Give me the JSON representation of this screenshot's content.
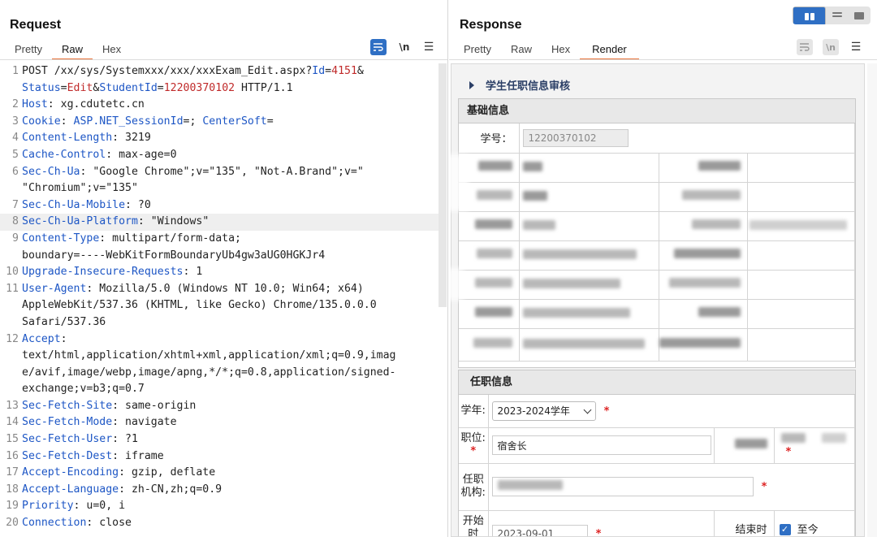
{
  "request": {
    "title": "Request",
    "tabs": [
      "Pretty",
      "Raw",
      "Hex"
    ],
    "active_tab": "Raw",
    "icons": {
      "wrap": "wrap-lines-icon",
      "newline": "\\n",
      "menu": "☰"
    },
    "lines": [
      {
        "n": "1",
        "parts": [
          [
            "plain",
            "POST /xx/sys/Systemxxx/xxx/xxxExam_Edit.aspx?"
          ],
          [
            "pk",
            "Id"
          ],
          [
            "plain",
            "="
          ],
          [
            "pv",
            "4151"
          ],
          [
            "plain",
            "&"
          ]
        ]
      },
      {
        "n": "",
        "parts": [
          [
            "pk",
            "Status"
          ],
          [
            "plain",
            "="
          ],
          [
            "pv",
            "Edit"
          ],
          [
            "plain",
            "&"
          ],
          [
            "pk",
            "StudentId"
          ],
          [
            "plain",
            "="
          ],
          [
            "pv",
            "12200370102"
          ],
          [
            "plain",
            " HTTP/1.1"
          ]
        ]
      },
      {
        "n": "2",
        "parts": [
          [
            "hn",
            "Host"
          ],
          [
            "plain",
            ": xg.cdutetc.cn"
          ]
        ]
      },
      {
        "n": "3",
        "parts": [
          [
            "hn",
            "Cookie"
          ],
          [
            "plain",
            ": "
          ],
          [
            "hn",
            "ASP.NET_SessionId"
          ],
          [
            "plain",
            "=; "
          ],
          [
            "hn",
            "CenterSoft"
          ],
          [
            "plain",
            "="
          ]
        ]
      },
      {
        "n": "4",
        "parts": [
          [
            "hn",
            "Content-Length"
          ],
          [
            "plain",
            ": 3219"
          ]
        ]
      },
      {
        "n": "5",
        "parts": [
          [
            "hn",
            "Cache-Control"
          ],
          [
            "plain",
            ": max-age=0"
          ]
        ]
      },
      {
        "n": "6",
        "parts": [
          [
            "hn",
            "Sec-Ch-Ua"
          ],
          [
            "plain",
            ": \"Google Chrome\";v=\"135\", \"Not-A.Brand\";v=\""
          ]
        ]
      },
      {
        "n": "",
        "parts": [
          [
            "plain",
            "\"Chromium\";v=\"135\""
          ]
        ]
      },
      {
        "n": "7",
        "parts": [
          [
            "hn",
            "Sec-Ch-Ua-Mobile"
          ],
          [
            "plain",
            ": ?0"
          ]
        ]
      },
      {
        "n": "8",
        "hl": true,
        "parts": [
          [
            "hn",
            "Sec-Ch-Ua-Platform"
          ],
          [
            "plain",
            ": \"Windows\""
          ]
        ]
      },
      {
        "n": "9",
        "parts": [
          [
            "hn",
            "Content-Type"
          ],
          [
            "plain",
            ": multipart/form-data;"
          ]
        ]
      },
      {
        "n": "",
        "parts": [
          [
            "plain",
            "boundary=----WebKitFormBoundaryUb4gw3aUG0HGKJr4"
          ]
        ]
      },
      {
        "n": "10",
        "parts": [
          [
            "hn",
            "Upgrade-Insecure-Requests"
          ],
          [
            "plain",
            ": 1"
          ]
        ]
      },
      {
        "n": "11",
        "parts": [
          [
            "hn",
            "User-Agent"
          ],
          [
            "plain",
            ": Mozilla/5.0 (Windows NT 10.0; Win64; x64)"
          ]
        ]
      },
      {
        "n": "",
        "parts": [
          [
            "plain",
            "AppleWebKit/537.36 (KHTML, like Gecko) Chrome/135.0.0.0"
          ]
        ]
      },
      {
        "n": "",
        "parts": [
          [
            "plain",
            "Safari/537.36"
          ]
        ]
      },
      {
        "n": "12",
        "parts": [
          [
            "hn",
            "Accept"
          ],
          [
            "plain",
            ":"
          ]
        ]
      },
      {
        "n": "",
        "parts": [
          [
            "plain",
            "text/html,application/xhtml+xml,application/xml;q=0.9,imag"
          ]
        ]
      },
      {
        "n": "",
        "parts": [
          [
            "plain",
            "e/avif,image/webp,image/apng,*/*;q=0.8,application/signed-"
          ]
        ]
      },
      {
        "n": "",
        "parts": [
          [
            "plain",
            "exchange;v=b3;q=0.7"
          ]
        ]
      },
      {
        "n": "13",
        "parts": [
          [
            "hn",
            "Sec-Fetch-Site"
          ],
          [
            "plain",
            ": same-origin"
          ]
        ]
      },
      {
        "n": "14",
        "parts": [
          [
            "hn",
            "Sec-Fetch-Mode"
          ],
          [
            "plain",
            ": navigate"
          ]
        ]
      },
      {
        "n": "15",
        "parts": [
          [
            "hn",
            "Sec-Fetch-User"
          ],
          [
            "plain",
            ": ?1"
          ]
        ]
      },
      {
        "n": "16",
        "parts": [
          [
            "hn",
            "Sec-Fetch-Dest"
          ],
          [
            "plain",
            ": iframe"
          ]
        ]
      },
      {
        "n": "17",
        "parts": [
          [
            "hn",
            "Accept-Encoding"
          ],
          [
            "plain",
            ": gzip, deflate"
          ]
        ]
      },
      {
        "n": "18",
        "parts": [
          [
            "hn",
            "Accept-Language"
          ],
          [
            "plain",
            ": zh-CN,zh;q=0.9"
          ]
        ]
      },
      {
        "n": "19",
        "parts": [
          [
            "hn",
            "Priority"
          ],
          [
            "plain",
            ": u=0, i"
          ]
        ]
      },
      {
        "n": "20",
        "parts": [
          [
            "hn",
            "Connection"
          ],
          [
            "plain",
            ": close"
          ]
        ]
      }
    ]
  },
  "response": {
    "title": "Response",
    "tabs": [
      "Pretty",
      "Raw",
      "Hex",
      "Render"
    ],
    "active_tab": "Render",
    "render": {
      "page_heading": "学生任职信息审核",
      "basic_title": "基础信息",
      "student_no_label": "学号：",
      "student_no_value": "12200370102",
      "job_title": "任职信息",
      "year_label": "学年:",
      "year_value": "2023-2024学年",
      "position_label": "职位:",
      "position_value": "宿舍长",
      "org_label": "任职机构:",
      "start_label": "开始时",
      "start_value": "2023-09-01",
      "end_label": "结束时",
      "until_now_label": "至今",
      "required_mark": "*"
    }
  },
  "colors": {
    "accent": "#2f6fc4",
    "tab_underline": "#e8733a",
    "header_name": "#1d56c5",
    "param_value": "#c02a2a"
  }
}
